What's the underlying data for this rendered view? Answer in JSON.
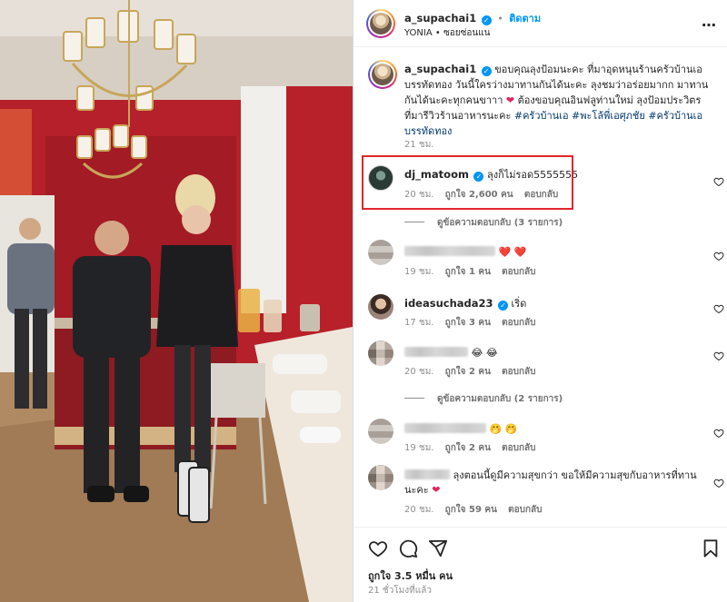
{
  "post": {
    "username": "a_supachai1",
    "follow_label": "ติดตาม",
    "separator": "•",
    "location_or_audio": "YONIA • ซอยซ่อนแน",
    "more_label": "…"
  },
  "caption": {
    "username": "a_supachai1",
    "text": "ขอบคุณลุงป้อมนะคะ ที่มาอุดหนุนร้านครัวบ้านเอ บรรทัดทอง วันนี้ใครว่างมาทานกันได้นะคะ ลุงชมว่าอร่อยมากก มาทานกันได้นะคะทุกคนขาาา",
    "text_after_heart": " ต้องขอบคุณอินฟลูท่านใหม่ ลุงป้อมประวิตร ที่มารีวิวร้านอาหารนะคะ ",
    "hashtags": "#ครัวบ้านเอ #พะโล้พี่เอศุภชัย #ครัวบ้านเอบรรทัดทอง",
    "time": "21 ชม."
  },
  "comments": [
    {
      "username": "dj_matoom",
      "text": "ลุงก็ไม่รอด5555555",
      "time": "20 ชม.",
      "likes": "ถูกใจ 2,600 คน",
      "reply_label": "ตอบกลับ",
      "view_replies": "ดูข้อความตอบกลับ (3 รายการ)"
    },
    {
      "text": "❤️ ❤️",
      "time": "19 ชม.",
      "likes": "ถูกใจ 1 คน",
      "reply_label": "ตอบกลับ"
    },
    {
      "username": "ideasuchada23",
      "text": "เริ่ด",
      "time": "17 ชม.",
      "likes": "ถูกใจ 3 คน",
      "reply_label": "ตอบกลับ"
    },
    {
      "text": "😂 😂",
      "time": "20 ชม.",
      "likes": "ถูกใจ 2 คน",
      "reply_label": "ตอบกลับ",
      "view_replies": "ดูข้อความตอบกลับ (2 รายการ)"
    },
    {
      "text": "🤭 🤭",
      "time": "19 ชม.",
      "likes": "ถูกใจ 2 คน",
      "reply_label": "ตอบกลับ"
    },
    {
      "text": "ลุงตอนนี้ดูมีความสุขกว่า ขอให้มีความสุขกับอาหารที่ทานนะคะ",
      "time": "20 ชม.",
      "likes": "ถูกใจ 59 คน",
      "reply_label": "ตอบกลับ"
    }
  ],
  "footer": {
    "likes_text": "ถูกใจ 3.5 หมื่น คน",
    "posted_ago": "21 ชั่วโมงที่แล้ว"
  },
  "colors": {
    "accent_blue": "#0095f6",
    "highlight_red": "#e0262b",
    "heart_red": "#e0245e"
  },
  "icons": [
    "heart-icon",
    "comment-icon",
    "share-icon",
    "bookmark-icon",
    "verified-badge-icon",
    "more-icon"
  ]
}
